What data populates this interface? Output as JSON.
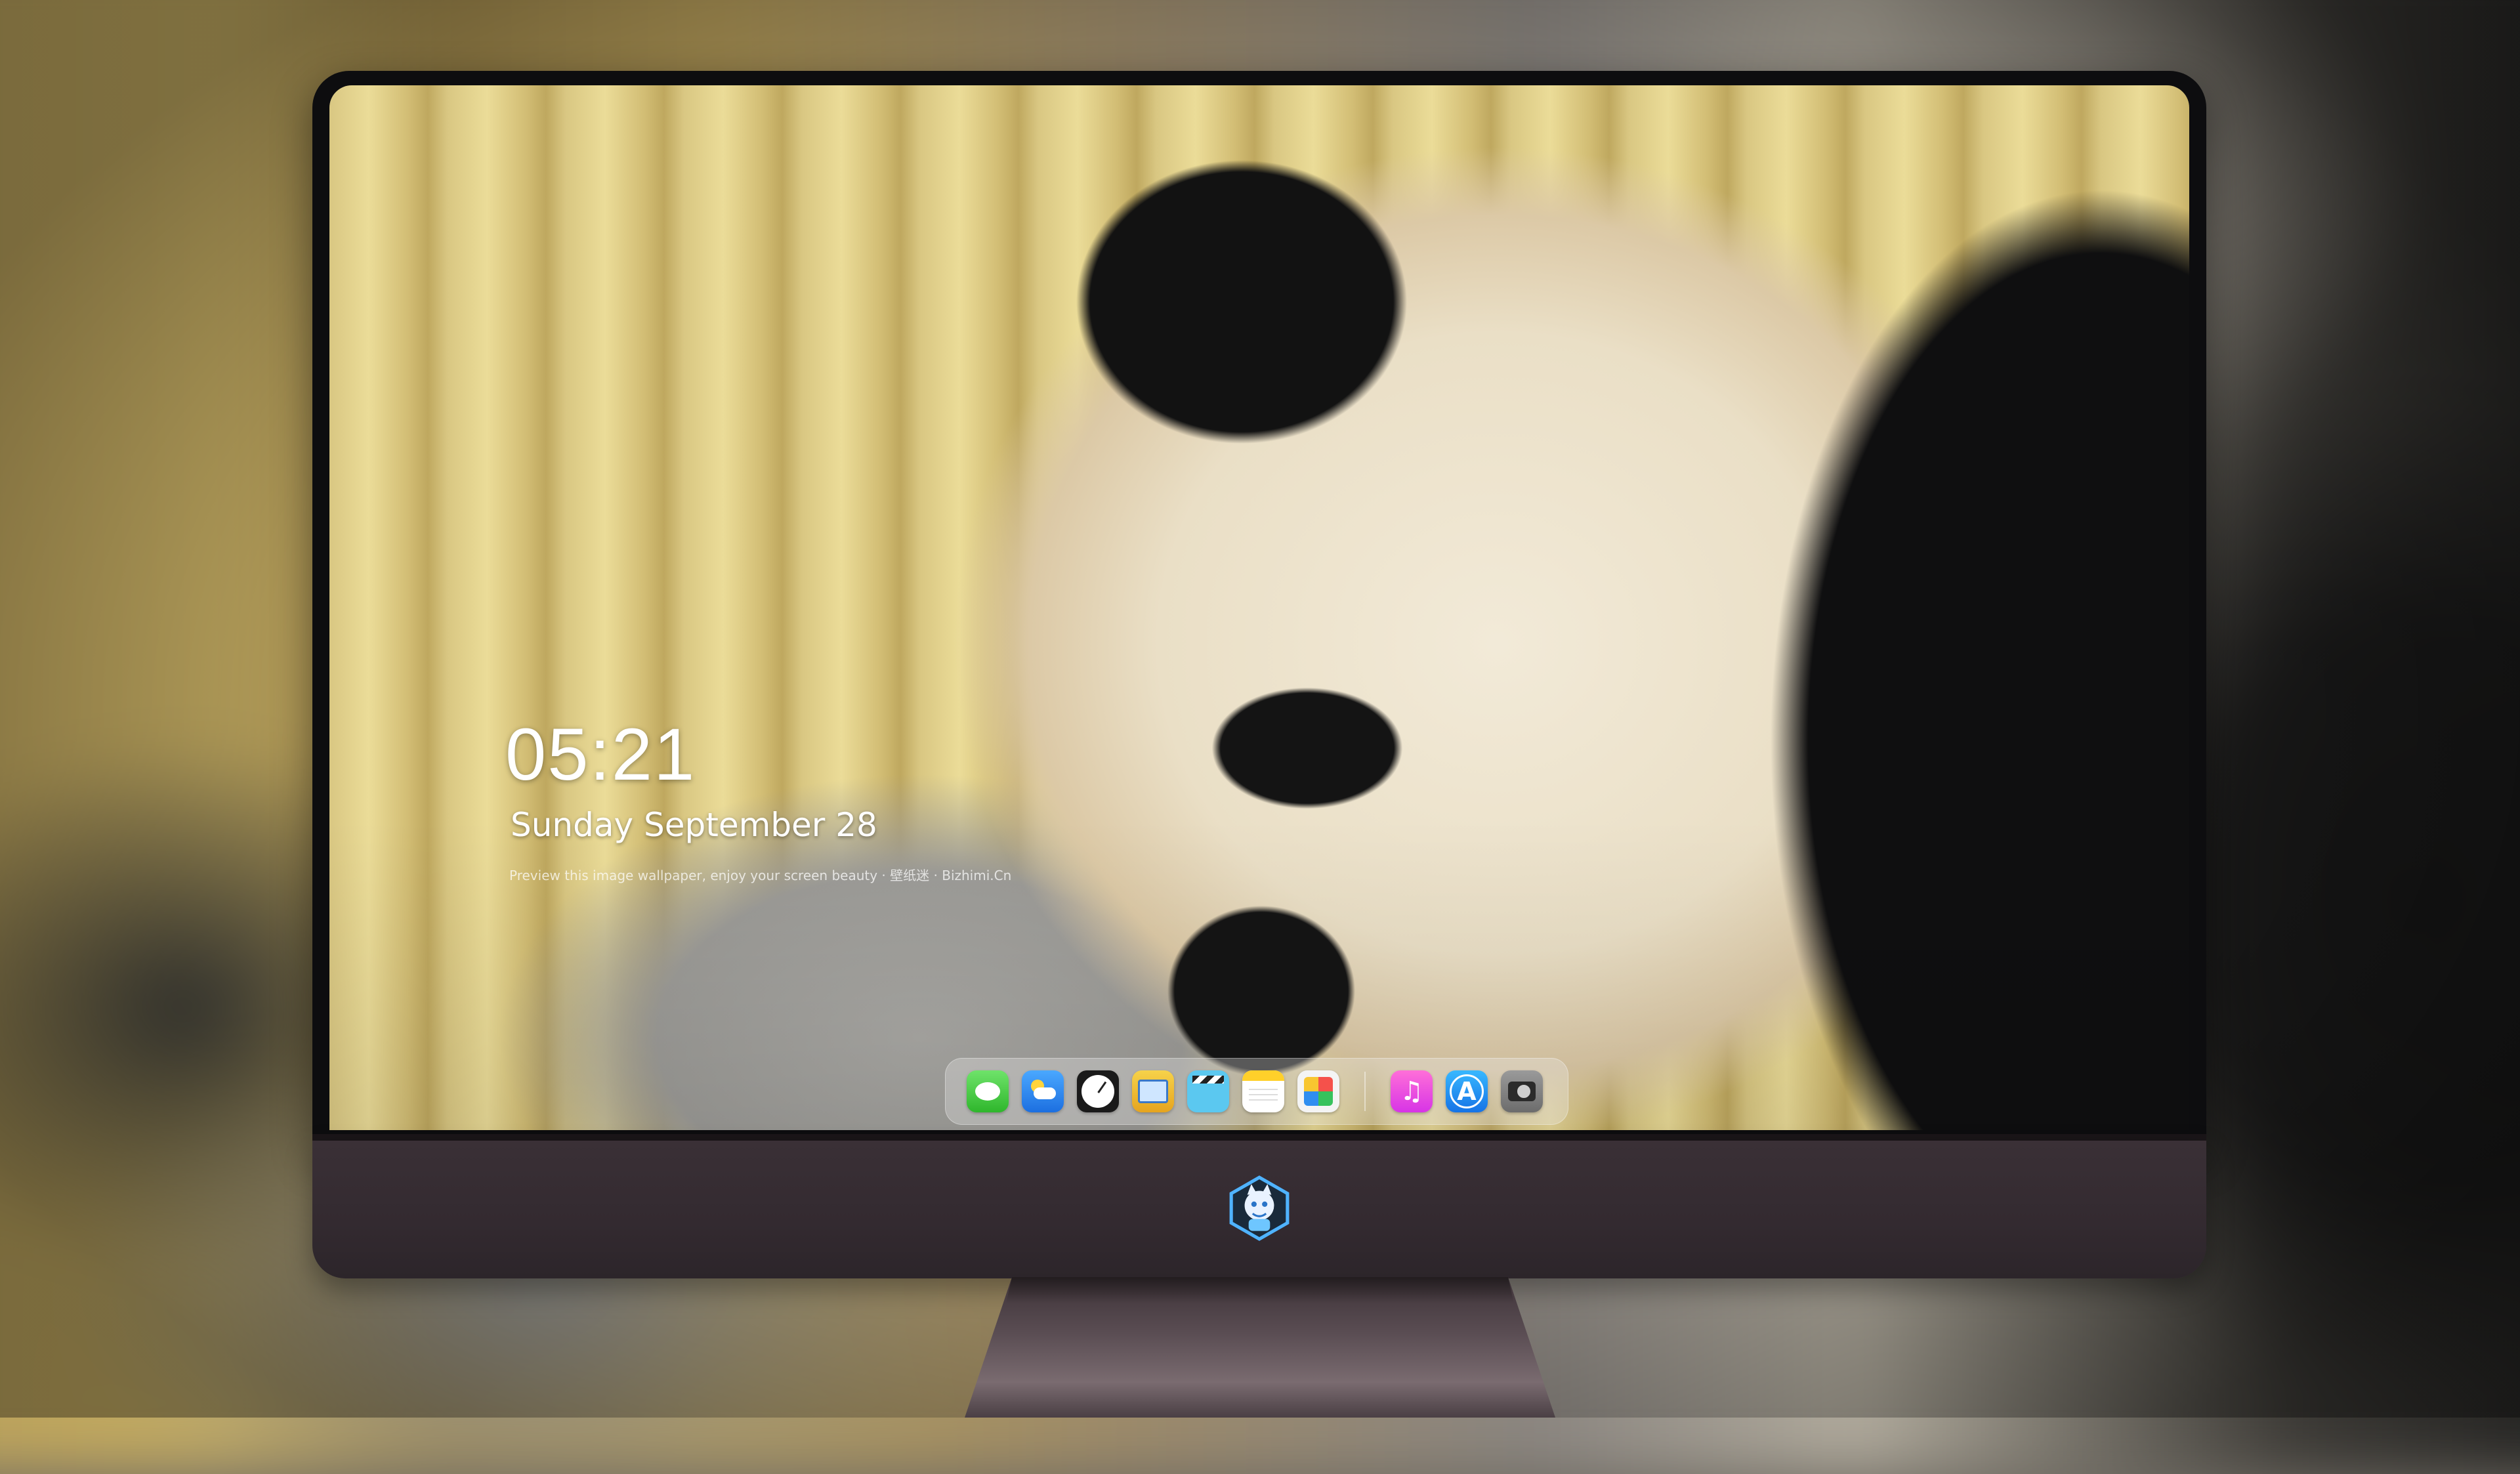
{
  "lock_screen": {
    "time": "05:21",
    "date": "Sunday September  28",
    "credit": "Preview this image wallpaper, enjoy your screen beauty · 壁纸迷 · Bizhimi.Cn"
  },
  "dock": {
    "apps": [
      {
        "name": "Messages",
        "icon": "messages-icon"
      },
      {
        "name": "Weather",
        "icon": "weather-icon"
      },
      {
        "name": "Clock",
        "icon": "clock-icon"
      },
      {
        "name": "Preview",
        "icon": "preview-icon"
      },
      {
        "name": "Clips",
        "icon": "clapperboard-icon"
      },
      {
        "name": "Notes",
        "icon": "notes-icon"
      },
      {
        "name": "Photos",
        "icon": "photos-icon"
      },
      {
        "name": "Music",
        "icon": "music-note-icon"
      },
      {
        "name": "App Store",
        "icon": "app-store-icon"
      },
      {
        "name": "Camera",
        "icon": "camera-icon"
      }
    ]
  },
  "colors": {
    "bezel": "#0d0d0f",
    "chin": "#332a30",
    "stand": "#5a4d53",
    "dock_bg": "rgba(235,235,235,0.32)"
  }
}
